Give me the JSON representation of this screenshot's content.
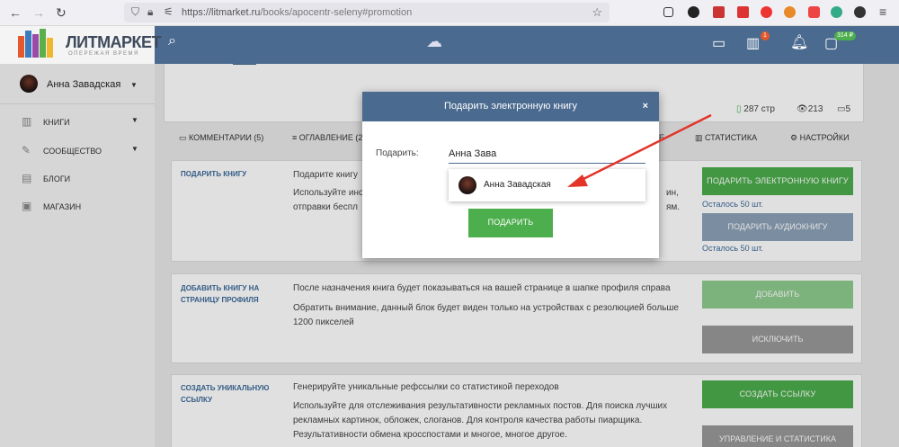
{
  "browser": {
    "url_host": "https://litmarket.ru",
    "url_path": "/books/apocentr-seleny#promotion"
  },
  "site": {
    "logo_title": "ЛИТМАРКЕТ",
    "logo_slogan": "ОПЕРЕЖАЯ ВРЕМЯ",
    "cart_badge": "1",
    "wallet_badge": "314 ₽"
  },
  "sidebar": {
    "user_name": "Анна Завадская",
    "items": [
      {
        "label": "КНИГИ",
        "icon": "books-icon"
      },
      {
        "label": "СООБЩЕСТВО",
        "icon": "feather-icon"
      },
      {
        "label": "БЛОГИ",
        "icon": "blog-icon"
      },
      {
        "label": "МАГАЗИН",
        "icon": "shop-icon"
      }
    ]
  },
  "stats": {
    "pages": "287 стр",
    "views": "213",
    "comments": "5"
  },
  "tabs": {
    "comments": "КОММЕНТАРИИ (5)",
    "contents": "ОГЛАВЛЕНИЕ (2",
    "stats": "СТАТИСТИКА",
    "settings": "НАСТРОЙКИ",
    "partial": "Е"
  },
  "sections": {
    "gift": {
      "title": "ПОДАРИТЬ КНИГУ",
      "line1": "Подарите книгу",
      "line2a": "Используйте инс",
      "line2b": "отправки беспл",
      "line2c": "ин,",
      "line2d": "ям.",
      "btn_ebook": "ПОДАРИТЬ ЭЛЕКТРОННУЮ КНИГУ",
      "left1": "Осталось 50 шт.",
      "btn_audio": "ПОДАРИТЬ АУДИОКНИГУ",
      "left2": "Осталось 50 шт."
    },
    "profile": {
      "title": "ДОБАВИТЬ КНИГУ НА СТРАНИЦУ ПРОФИЛЯ",
      "line1": "После назначения книга будет показываться на вашей странице в шапке профиля справа",
      "line2": "Обратить внимание, данный блок будет виден только на устройствах с резолюцией больше 1200 пикселей",
      "btn_add": "ДОБАВИТЬ",
      "btn_exclude": "ИСКЛЮЧИТЬ"
    },
    "link": {
      "title": "СОЗДАТЬ УНИКАЛЬНУЮ ССЫЛКУ",
      "line1": "Генерируйте уникальные рефссылки со статистикой переходов",
      "line2": "Используйте для отслеживания результативности рекламных постов. Для поиска лучших рекламных картинок, обложек, слоганов. Для контроля качества работы пиарщика. Результативности обмена кросспостами и многое, многое другое.",
      "btn_create": "СОЗДАТЬ ССЫЛКУ",
      "btn_manage": "УПРАВЛЕНИЕ И СТАТИСТИКА"
    }
  },
  "modal": {
    "title": "Подарить электронную книгу",
    "close": "×",
    "label": "Подарить:",
    "input_value": "Анна Зава",
    "suggestion": "Анна Завадская",
    "submit": "ПОДАРИТЬ"
  }
}
